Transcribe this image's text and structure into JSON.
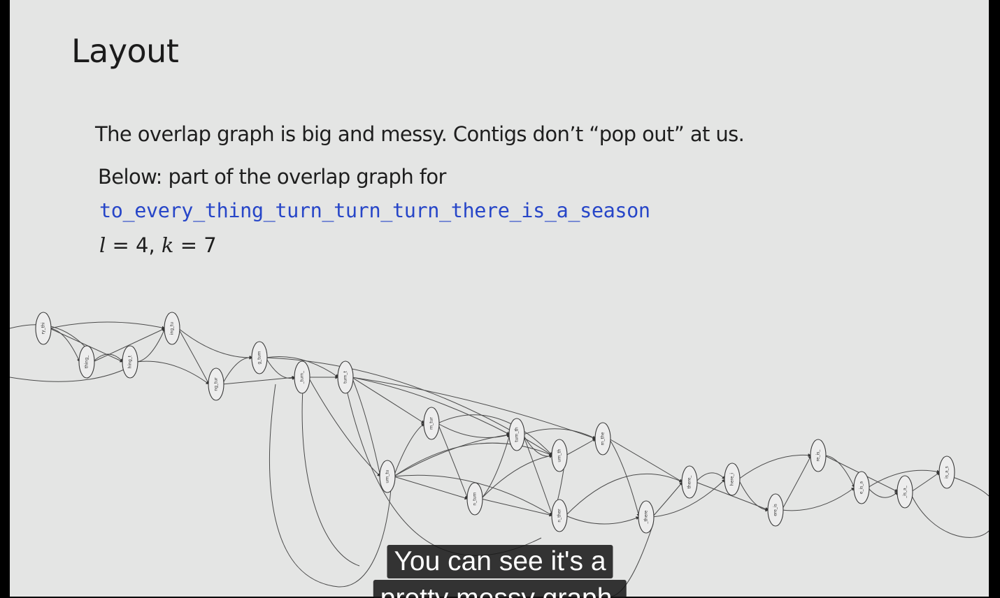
{
  "slide": {
    "title": "Layout",
    "line_1": "The overlap graph is big and messy.  Contigs don’t “pop out” at us.",
    "line_2": "Below: part of the overlap graph for",
    "code": "to_every_thing_turn_turn_turn_there_is_a_season",
    "params": {
      "l_var": "l",
      "l_eq": " = 4, ",
      "k_var": "k",
      "k_eq": " = 7"
    }
  },
  "graph": {
    "nodes": [
      {
        "id": "n1",
        "label": "ry_thi"
      },
      {
        "id": "n2",
        "label": "thing_"
      },
      {
        "id": "n3",
        "label": "hing_t"
      },
      {
        "id": "n4",
        "label": "ing_tu"
      },
      {
        "id": "n5",
        "label": "ng_tur"
      },
      {
        "id": "n6",
        "label": "g_turn"
      },
      {
        "id": "n7",
        "label": "_turn_"
      },
      {
        "id": "n8",
        "label": "turn_t"
      },
      {
        "id": "n9",
        "label": "urn_tu"
      },
      {
        "id": "n10",
        "label": "rn_tur"
      },
      {
        "id": "n11",
        "label": "n_turn"
      },
      {
        "id": "n12",
        "label": "turn_th"
      },
      {
        "id": "n13",
        "label": "urn_th"
      },
      {
        "id": "n14",
        "label": "rn_the"
      },
      {
        "id": "n15",
        "label": "n_ther"
      },
      {
        "id": "n16",
        "label": "_there"
      },
      {
        "id": "n17",
        "label": "there_"
      },
      {
        "id": "n18",
        "label": "here_i"
      },
      {
        "id": "n19",
        "label": "ere_is"
      },
      {
        "id": "n20",
        "label": "re_is_"
      },
      {
        "id": "n21",
        "label": "e_is_a"
      },
      {
        "id": "n22",
        "label": "_is_a_"
      },
      {
        "id": "n23",
        "label": "is_a_s"
      }
    ]
  },
  "captions": {
    "line_1": "You can see it's a",
    "line_2": "pretty messy graph."
  }
}
